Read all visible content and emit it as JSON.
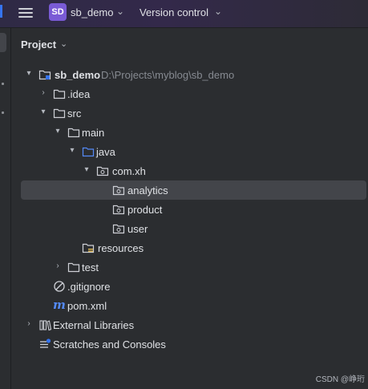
{
  "topbar": {
    "project_badge": "SD",
    "project_name": "sb_demo",
    "version_control": "Version control",
    "badge_color": "#7a5bd6"
  },
  "panel": {
    "title": "Project"
  },
  "tree": {
    "root": {
      "label": "sb_demo",
      "path": "D:\\Projects\\myblog\\sb_demo"
    },
    "idea": ".idea",
    "src": "src",
    "main": "main",
    "java": "java",
    "package": "com.xh",
    "analytics": "analytics",
    "product": "product",
    "user": "user",
    "resources": "resources",
    "test": "test",
    "gitignore": ".gitignore",
    "pom": "pom.xml",
    "external_libraries": "External Libraries",
    "scratches": "Scratches and Consoles"
  },
  "watermark": "CSDN @峥珩"
}
